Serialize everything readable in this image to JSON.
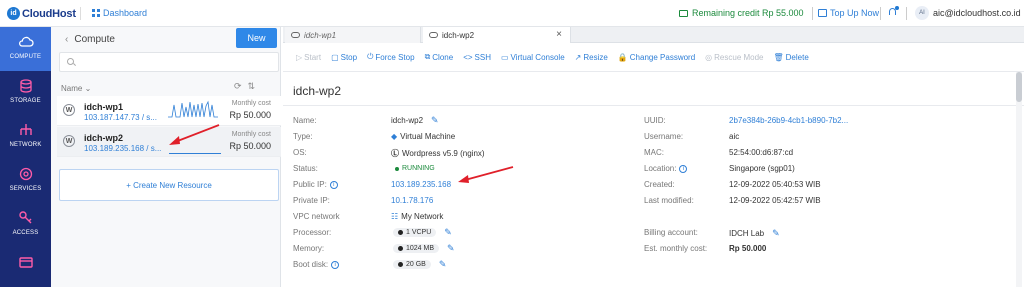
{
  "header": {
    "logo_text": "CloudHost",
    "logo_badge": "id",
    "dashboard_label": "Dashboard",
    "credit_label": "Remaining credit Rp 55.000",
    "topup_label": "Top Up Now",
    "user_initials": "AI",
    "user_email": "aic@idcloudhost.co.id"
  },
  "sidenav": {
    "items": [
      {
        "label": "COMPUTE",
        "icon": "cloud-icon"
      },
      {
        "label": "STORAGE",
        "icon": "database-icon"
      },
      {
        "label": "NETWORK",
        "icon": "network-icon"
      },
      {
        "label": "SERVICES",
        "icon": "services-icon"
      },
      {
        "label": "ACCESS",
        "icon": "key-icon"
      },
      {
        "label": "",
        "icon": "billing-icon"
      }
    ]
  },
  "panel": {
    "title": "Compute",
    "new_button": "New",
    "search_placeholder": "",
    "sort_label": "Name",
    "rows": [
      {
        "name": "idch-wp1",
        "ip": "103.187.147.73 / s...",
        "cost_label": "Monthly cost",
        "price": "Rp 50.000"
      },
      {
        "name": "idch-wp2",
        "ip": "103.189.235.168 / s...",
        "cost_label": "Monthly cost",
        "price": "Rp 50.000"
      }
    ],
    "create_label": "+ Create New Resource"
  },
  "tabs": [
    {
      "label": "idch-wp1"
    },
    {
      "label": "idch-wp2"
    }
  ],
  "actions": [
    {
      "label": "Start",
      "icon": "play-icon",
      "enabled": false
    },
    {
      "label": "Stop",
      "icon": "stop-icon",
      "enabled": true
    },
    {
      "label": "Force Stop",
      "icon": "power-icon",
      "enabled": true
    },
    {
      "label": "Clone",
      "icon": "clone-icon",
      "enabled": true
    },
    {
      "label": "SSH",
      "icon": "code-icon",
      "enabled": true
    },
    {
      "label": "Virtual Console",
      "icon": "monitor-icon",
      "enabled": true
    },
    {
      "label": "Resize",
      "icon": "resize-icon",
      "enabled": true
    },
    {
      "label": "Change Password",
      "icon": "lock-icon",
      "enabled": true
    },
    {
      "label": "Rescue Mode",
      "icon": "lifebuoy-icon",
      "enabled": false
    },
    {
      "label": "Delete",
      "icon": "trash-icon",
      "enabled": true
    }
  ],
  "vm": {
    "title": "idch-wp2",
    "left": {
      "name_label": "Name:",
      "name": "idch-wp2",
      "type_label": "Type:",
      "type": "Virtual Machine",
      "os_label": "OS:",
      "os": "Wordpress v5.9 (nginx)",
      "status_label": "Status:",
      "status": "RUNNING",
      "public_ip_label": "Public IP:",
      "public_ip": "103.189.235.168",
      "private_ip_label": "Private IP:",
      "private_ip": "10.1.78.176",
      "vpc_label": "VPC network",
      "vpc": "My Network",
      "processor_label": "Processor:",
      "processor": "1 VCPU",
      "memory_label": "Memory:",
      "memory": "1024 MB",
      "boot_label": "Boot disk:",
      "boot": "20 GB"
    },
    "right": {
      "uuid_label": "UUID:",
      "uuid": "2b7e384b-26b9-4cb1-b890-7b2...",
      "username_label": "Username:",
      "username": "aic",
      "mac_label": "MAC:",
      "mac": "52:54:00:d6:87:cd",
      "location_label": "Location:",
      "location": "Singapore (sgp01)",
      "created_label": "Created:",
      "created": "12-09-2022 05:40:53 WIB",
      "modified_label": "Last modified:",
      "modified": "12-09-2022 05:42:57 WIB",
      "billing_label": "Billing account:",
      "billing": "IDCH Lab",
      "cost_label": "Est. monthly cost:",
      "cost": "Rp 50.000"
    }
  },
  "colors": {
    "accent": "#2f88e8",
    "nav": "#1a2a73",
    "nav_active": "#3a6fd8",
    "running": "#1b8a3c",
    "annotation": "#e0202a"
  }
}
